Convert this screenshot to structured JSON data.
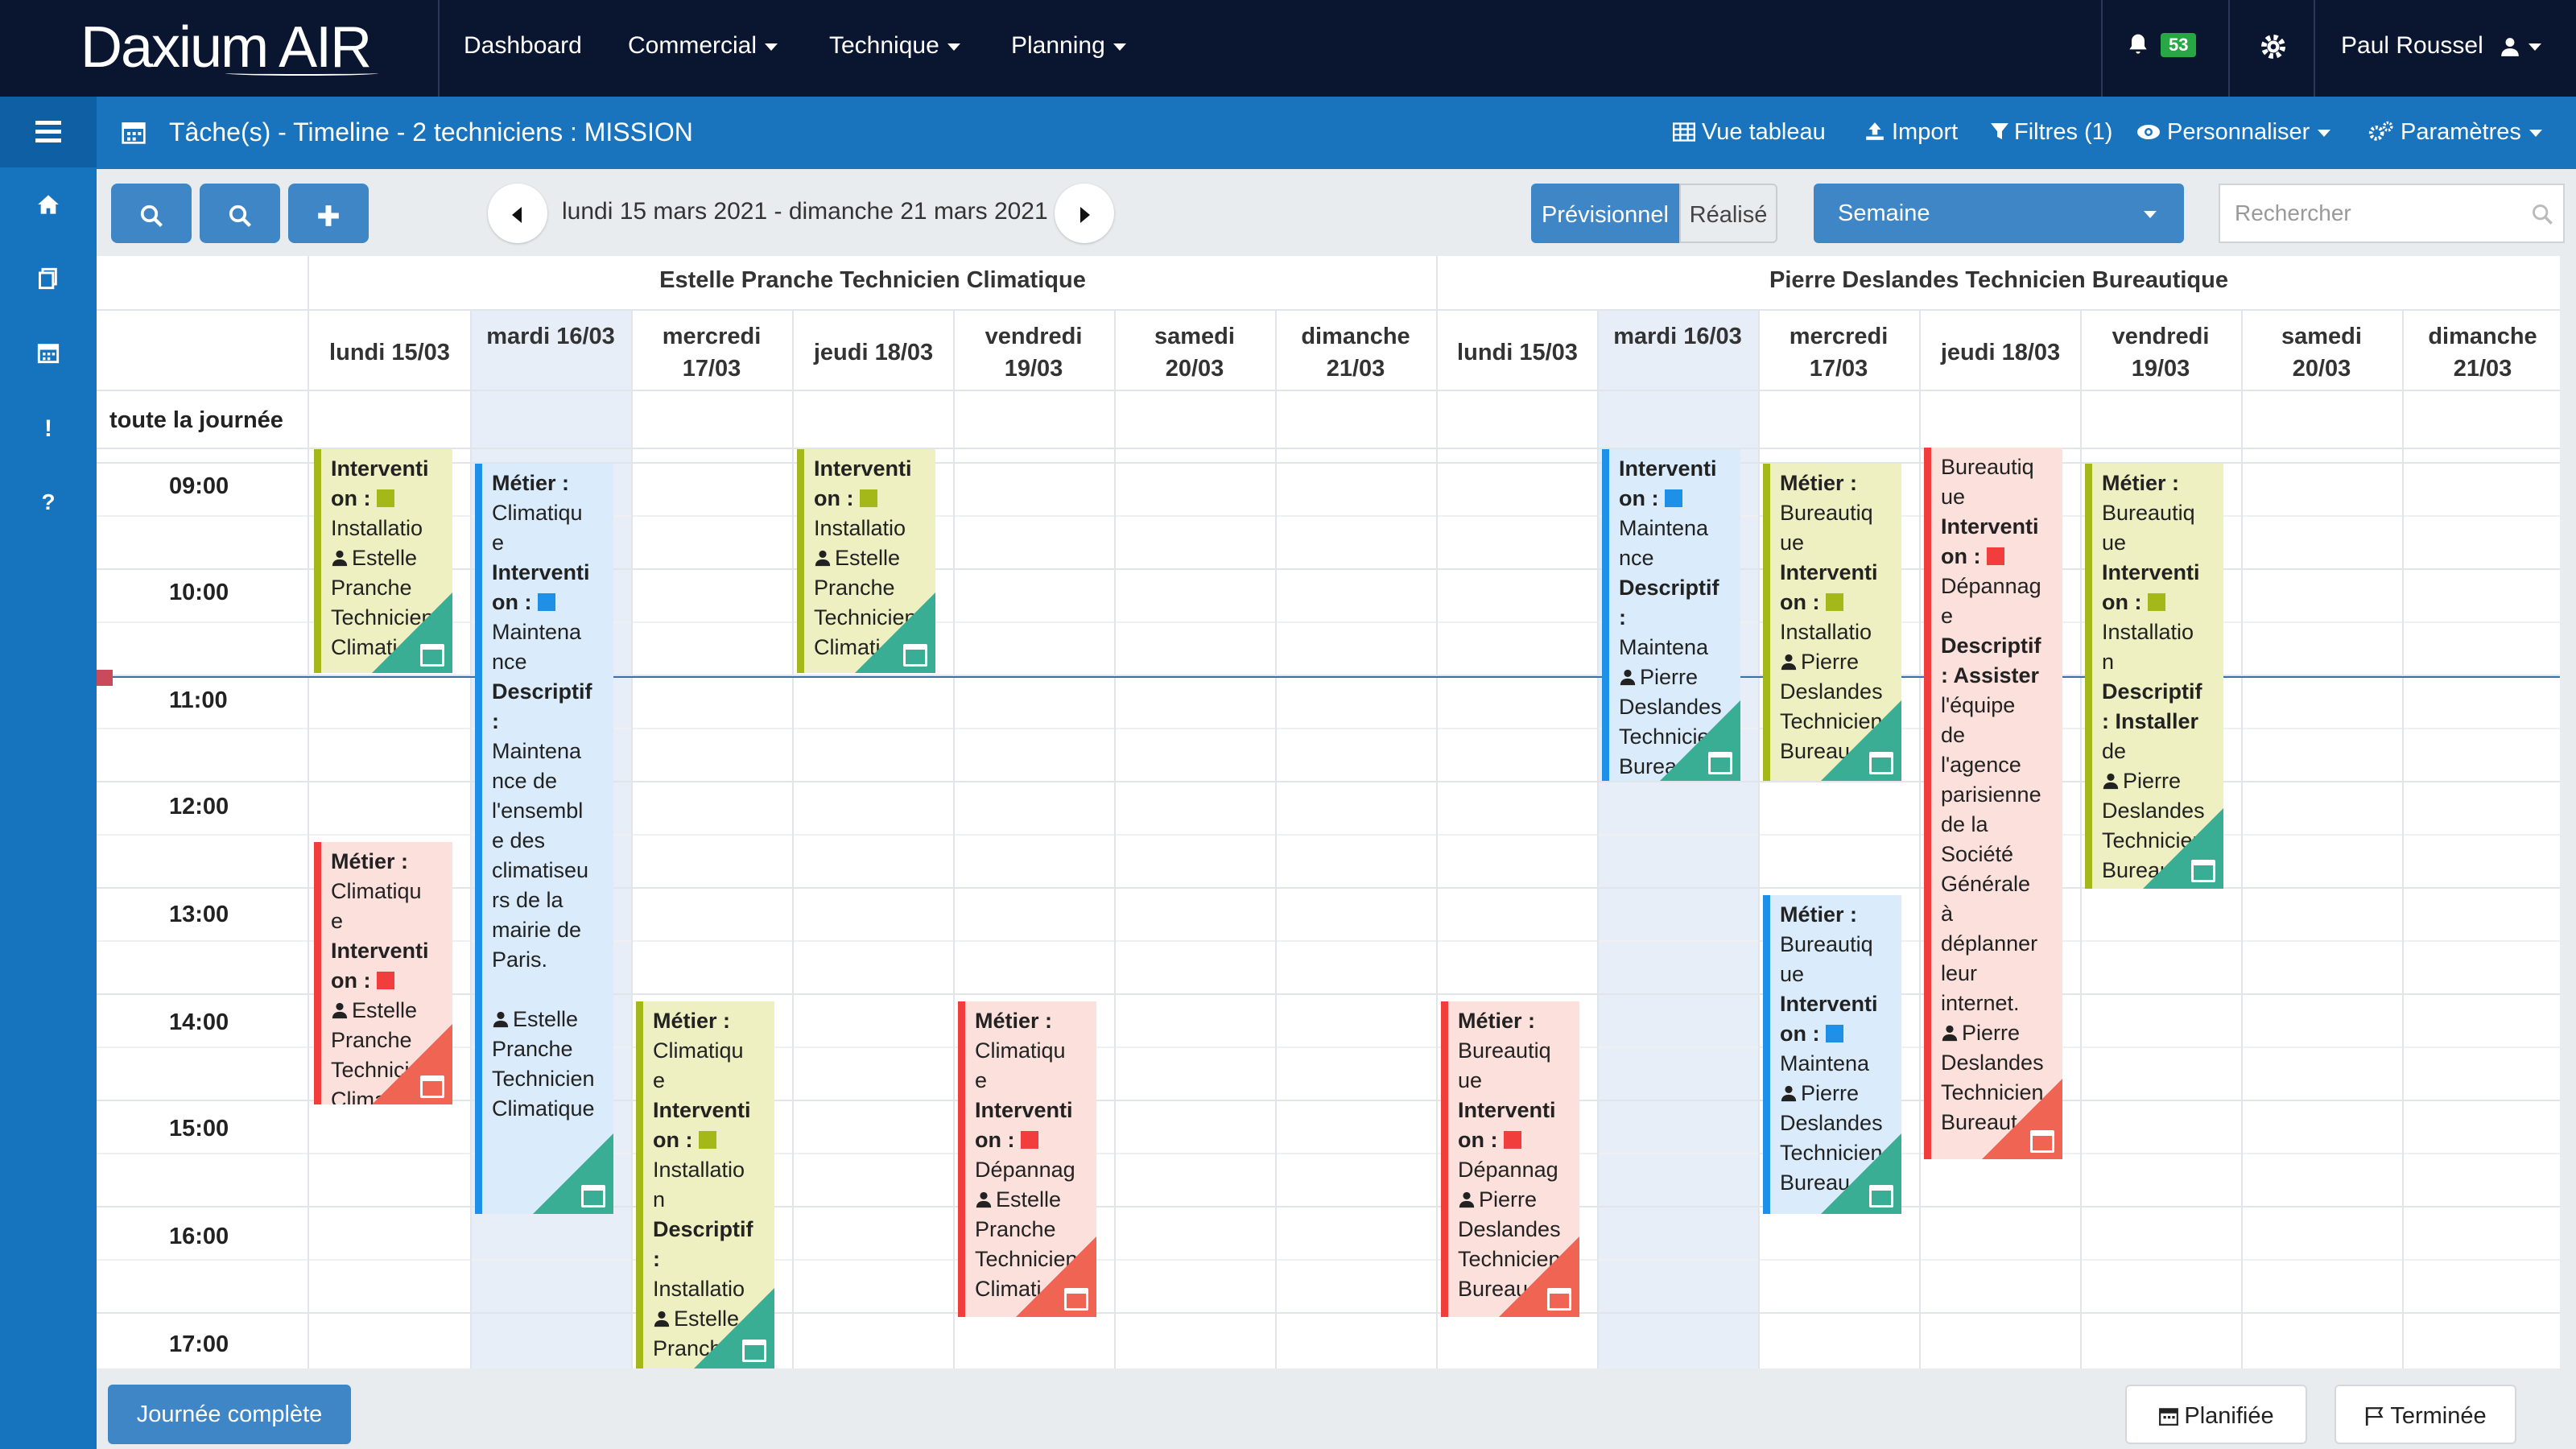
{
  "app": {
    "logo": "Daxium AIR",
    "nav": [
      "Dashboard",
      "Commercial",
      "Technique",
      "Planning"
    ],
    "notif_count": "53",
    "user": "Paul Roussel"
  },
  "subheader": {
    "title": "Tâche(s) - Timeline - 2 techniciens : MISSION",
    "actions": [
      "Vue tableau",
      "Import",
      "Filtres (1)",
      "Personnaliser",
      "Paramètres"
    ]
  },
  "toolbar": {
    "date_range": "lundi 15 mars 2021 - dimanche 21 mars 2021",
    "previsionnel": "Prévisionnel",
    "realise": "Réalisé",
    "view": "Semaine",
    "search_placeholder": "Rechercher"
  },
  "calendar": {
    "technicians": [
      "Estelle Pranche Technicien Climatique",
      "Pierre Deslandes Technicien Bureautique"
    ],
    "days": [
      "lundi 15/03",
      "mardi 16/03",
      "mercredi 17/03",
      "jeudi 18/03",
      "vendredi 19/03",
      "samedi 20/03",
      "dimanche 21/03"
    ],
    "allday_label": "toute la journée",
    "hours": [
      "09:00",
      "10:00",
      "11:00",
      "12:00",
      "13:00",
      "14:00",
      "15:00",
      "16:00",
      "17:00"
    ]
  },
  "colors": {
    "installation": "#a4b81a",
    "maintenance": "#1e90e8",
    "depannage": "#f23d3d"
  },
  "events": [
    {
      "lines": [
        [
          "b",
          "Interventi"
        ],
        [
          "b",
          "on :",
          "sq-installation"
        ],
        [
          "t",
          "Installatio"
        ],
        [
          "u",
          "Estelle"
        ],
        [
          "t",
          "Pranche"
        ],
        [
          "t",
          "Technicien"
        ],
        [
          "t",
          "Climati"
        ]
      ]
    },
    {
      "lines": [
        [
          "b",
          "Métier :"
        ],
        [
          "t",
          "Climatiqu"
        ],
        [
          "t",
          "e"
        ],
        [
          "b",
          "Interventi"
        ],
        [
          "b",
          "on :",
          "sq-maintenance"
        ],
        [
          "t",
          "Maintena"
        ],
        [
          "t",
          "nce"
        ],
        [
          "b",
          "Descriptif"
        ],
        [
          "b",
          ":"
        ],
        [
          "t",
          "Maintena"
        ],
        [
          "t",
          "nce de"
        ],
        [
          "t",
          "l'ensembl"
        ],
        [
          "t",
          "e des"
        ],
        [
          "t",
          "climatiseu"
        ],
        [
          "t",
          "rs de la"
        ],
        [
          "t",
          "mairie de"
        ],
        [
          "t",
          "Paris."
        ],
        [
          "t",
          ""
        ],
        [
          "u",
          "Estelle"
        ],
        [
          "t",
          "Pranche"
        ],
        [
          "t",
          "Technicien"
        ],
        [
          "t",
          "Climatique"
        ]
      ]
    },
    {
      "lines": [
        [
          "b",
          "Interventi"
        ],
        [
          "b",
          "on :",
          "sq-installation"
        ],
        [
          "t",
          "Installatio"
        ],
        [
          "u",
          "Estelle"
        ],
        [
          "t",
          "Pranche"
        ],
        [
          "t",
          "Technicien"
        ],
        [
          "t",
          "Climati"
        ]
      ]
    },
    {
      "lines": [
        [
          "b",
          "Métier :"
        ],
        [
          "t",
          "Climatiqu"
        ],
        [
          "t",
          "e"
        ],
        [
          "b",
          "Interventi"
        ],
        [
          "b",
          "on :",
          "sq-depannage"
        ],
        [
          "u",
          "Estelle"
        ],
        [
          "t",
          "Pranche"
        ],
        [
          "t",
          "Technicien"
        ],
        [
          "t",
          "Climati"
        ]
      ]
    },
    {
      "lines": [
        [
          "b",
          "Métier :"
        ],
        [
          "t",
          "Climatiqu"
        ],
        [
          "t",
          "e"
        ],
        [
          "b",
          "Interventi"
        ],
        [
          "b",
          "on :",
          "sq-installation"
        ],
        [
          "t",
          "Installatio"
        ],
        [
          "t",
          "n"
        ],
        [
          "b",
          "Descriptif"
        ],
        [
          "b",
          ":"
        ],
        [
          "t",
          "Installatio"
        ],
        [
          "u",
          "Estelle"
        ],
        [
          "t",
          "Pranche"
        ]
      ]
    },
    {
      "lines": [
        [
          "b",
          "Métier :"
        ],
        [
          "t",
          "Climatiqu"
        ],
        [
          "t",
          "e"
        ],
        [
          "b",
          "Interventi"
        ],
        [
          "b",
          "on :",
          "sq-depannage"
        ],
        [
          "t",
          "Dépannag"
        ],
        [
          "u",
          "Estelle"
        ],
        [
          "t",
          "Pranche"
        ],
        [
          "t",
          "Technicien"
        ],
        [
          "t",
          "Climati"
        ]
      ]
    },
    {
      "lines": [
        [
          "b",
          "Métier :"
        ],
        [
          "t",
          "Bureautiq"
        ],
        [
          "t",
          "ue"
        ],
        [
          "b",
          "Interventi"
        ],
        [
          "b",
          "on :",
          "sq-depannage"
        ],
        [
          "t",
          "Dépannag"
        ],
        [
          "u",
          "Pierre"
        ],
        [
          "t",
          "Deslandes"
        ],
        [
          "t",
          "Technicien"
        ],
        [
          "t",
          "Bureau"
        ]
      ]
    },
    {
      "lines": [
        [
          "b",
          "Interventi"
        ],
        [
          "b",
          "on :",
          "sq-maintenance"
        ],
        [
          "t",
          "Maintena"
        ],
        [
          "t",
          "nce"
        ],
        [
          "b",
          "Descriptif"
        ],
        [
          "b",
          ":"
        ],
        [
          "t",
          "Maintena"
        ],
        [
          "u",
          "Pierre"
        ],
        [
          "t",
          "Deslandes"
        ],
        [
          "t",
          "Technicien"
        ],
        [
          "t",
          "Bureau"
        ]
      ]
    },
    {
      "lines": [
        [
          "b",
          "Métier :"
        ],
        [
          "t",
          "Bureautiq"
        ],
        [
          "t",
          "ue"
        ],
        [
          "b",
          "Interventi"
        ],
        [
          "b",
          "on :",
          "sq-installation"
        ],
        [
          "t",
          "Installatio"
        ],
        [
          "u",
          "Pierre"
        ],
        [
          "t",
          "Deslandes"
        ],
        [
          "t",
          "Technicien"
        ],
        [
          "t",
          "Bureau"
        ]
      ]
    },
    {
      "lines": [
        [
          "b",
          "Métier :"
        ],
        [
          "t",
          "Bureautiq"
        ],
        [
          "t",
          "ue"
        ],
        [
          "b",
          "Interventi"
        ],
        [
          "b",
          "on :",
          "sq-maintenance"
        ],
        [
          "t",
          "Maintena"
        ],
        [
          "u",
          "Pierre"
        ],
        [
          "t",
          "Deslandes"
        ],
        [
          "t",
          "Technicien"
        ],
        [
          "t",
          "Bureau"
        ]
      ]
    },
    {
      "lines": [
        [
          "t",
          "Bureautiq"
        ],
        [
          "t",
          "ue"
        ],
        [
          "b",
          "Interventi"
        ],
        [
          "b",
          "on :",
          "sq-depannage"
        ],
        [
          "t",
          "Dépannag"
        ],
        [
          "t",
          "e"
        ],
        [
          "b",
          "Descriptif"
        ],
        [
          "b",
          ": Assister"
        ],
        [
          "t",
          "l'équipe"
        ],
        [
          "t",
          "de"
        ],
        [
          "t",
          "l'agence"
        ],
        [
          "t",
          "parisienne"
        ],
        [
          "t",
          "de la"
        ],
        [
          "t",
          "Société"
        ],
        [
          "t",
          "Générale"
        ],
        [
          "t",
          "à"
        ],
        [
          "t",
          "déplanner"
        ],
        [
          "t",
          "leur"
        ],
        [
          "t",
          "internet."
        ],
        [
          "u",
          "Pierre"
        ],
        [
          "t",
          "Deslandes"
        ],
        [
          "t",
          "Technicien"
        ],
        [
          "t",
          "Bureaut"
        ]
      ]
    },
    {
      "lines": [
        [
          "b",
          "Métier :"
        ],
        [
          "t",
          "Bureautiq"
        ],
        [
          "t",
          "ue"
        ],
        [
          "b",
          "Interventi"
        ],
        [
          "b",
          "on :",
          "sq-installation"
        ],
        [
          "t",
          "Installatio"
        ],
        [
          "t",
          "n"
        ],
        [
          "b",
          "Descriptif"
        ],
        [
          "b",
          ": Installer"
        ],
        [
          "t",
          "de"
        ],
        [
          "u",
          "Pierre"
        ],
        [
          "t",
          "Deslandes"
        ],
        [
          "t",
          "Technicien"
        ],
        [
          "t",
          "Bureau"
        ]
      ]
    }
  ],
  "footer": {
    "journee_complete": "Journée complète",
    "planifiee": "Planifiée",
    "terminee": "Terminée"
  }
}
